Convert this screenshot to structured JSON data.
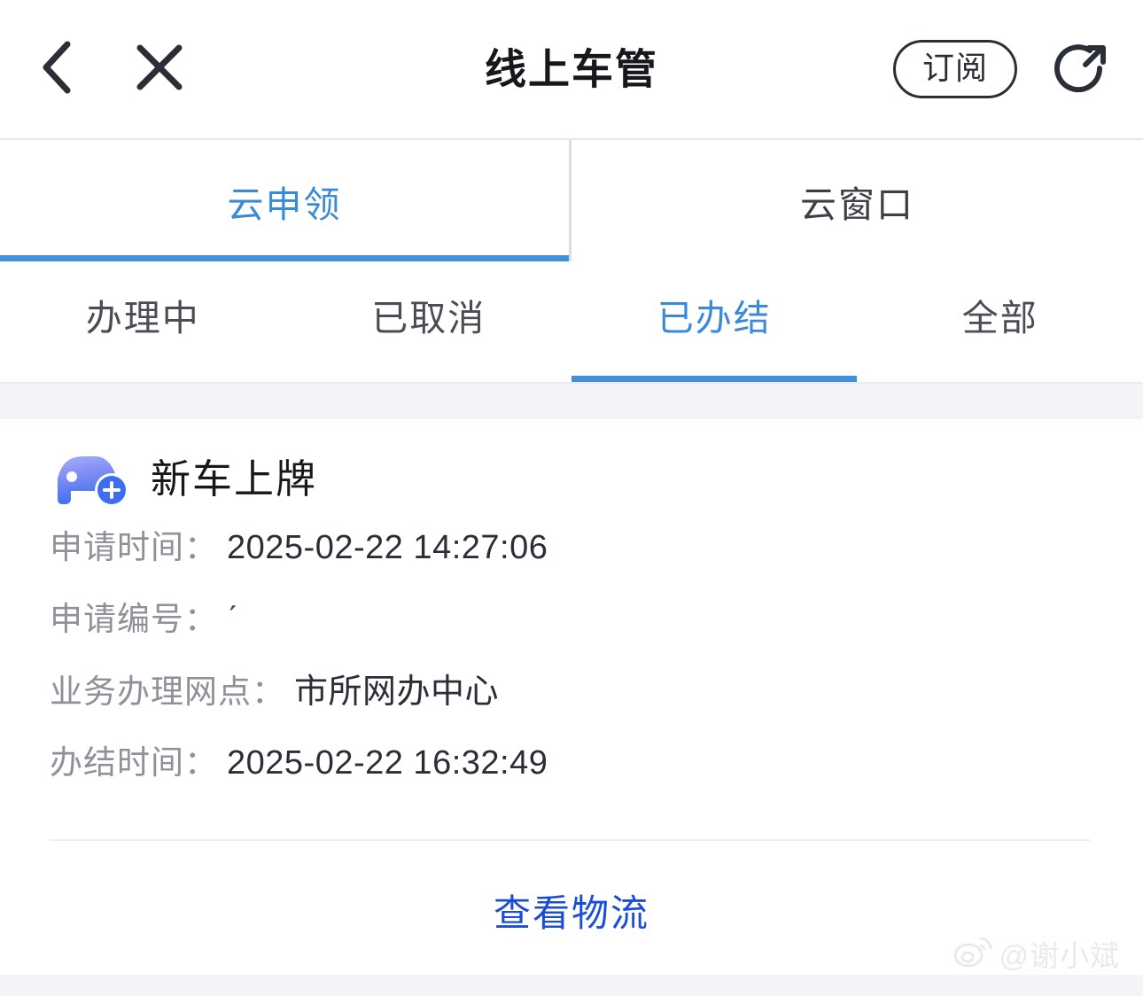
{
  "header": {
    "title": "线上车管",
    "back_icon": "chevron-left-icon",
    "close_icon": "close-icon",
    "subscribe_label": "订阅",
    "share_icon": "share-icon"
  },
  "top_tabs": [
    {
      "label": "云申领",
      "active": true
    },
    {
      "label": "云窗口",
      "active": false
    }
  ],
  "sub_tabs": [
    {
      "label": "办理中",
      "active": false
    },
    {
      "label": "已取消",
      "active": false
    },
    {
      "label": "已办结",
      "active": true
    },
    {
      "label": "全部",
      "active": false
    }
  ],
  "card": {
    "icon": "car-plus-icon",
    "title": "新车上牌",
    "rows": [
      {
        "label": "申请时间：",
        "value": "2025-02-22 14:27:06"
      },
      {
        "label": "申请编号：",
        "value": "ˊ"
      },
      {
        "label": "业务办理网点：",
        "value": "市所网办中心"
      },
      {
        "label": "办结时间：",
        "value": "2025-02-22 16:32:49"
      }
    ],
    "action_label": "查看物流"
  },
  "watermark": {
    "icon": "weibo-icon",
    "text": "@谢小斌"
  },
  "colors": {
    "accent_blue": "#4090da",
    "tab_active_text": "#3b8ad8",
    "link_blue": "#1b4ed8",
    "label_gray": "#8e9199",
    "value_dark": "#2b2e36",
    "page_bg": "#f2f4f7",
    "card_bg": "#ffffff"
  }
}
